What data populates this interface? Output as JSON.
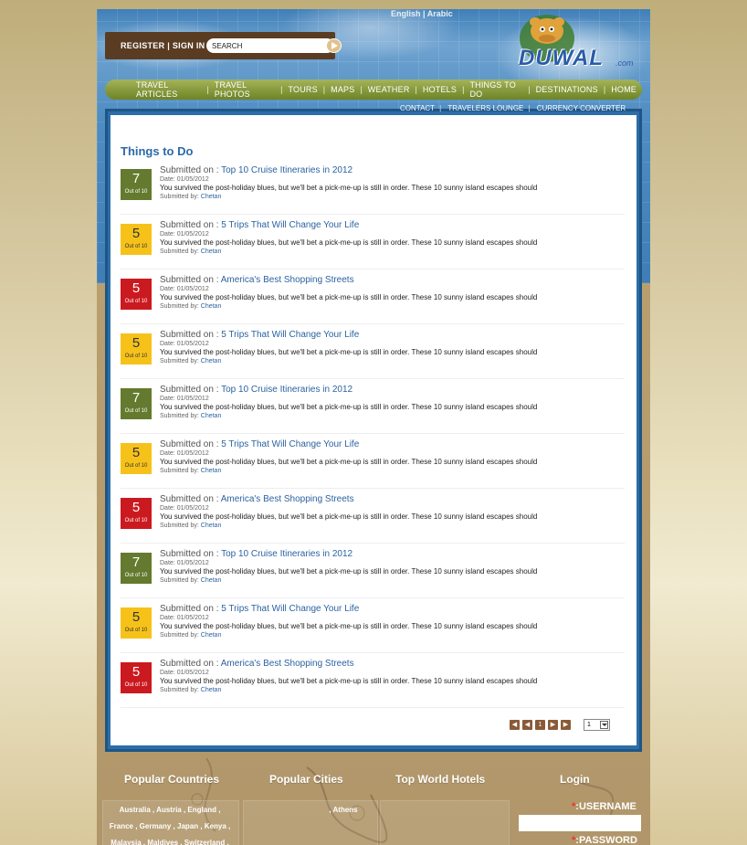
{
  "header": {
    "lang_english": "English",
    "lang_sep": "|",
    "lang_arabic": "Arabic",
    "register": "REGISTER",
    "auth_sep": "|",
    "signin": "SIGN IN",
    "search_placeholder": "SEARCH",
    "logo_text": "DUWAL",
    "logo_domain": ".com"
  },
  "nav": [
    "TRAVEL ARTICLES",
    "TRAVEL PHOTOS",
    "TOURS",
    "MAPS",
    "WEATHER",
    "HOTELS",
    "THINGS TO DO",
    "DESTINATIONS",
    "HOME"
  ],
  "subnav": [
    "CONTACT",
    "TRAVELERS LOUNGE",
    "CURRENCY CONVERTER"
  ],
  "page": {
    "heading": "Things to Do",
    "submitted_on_label": "Submitted on :",
    "date_label": "Date:",
    "submitted_by_label": "Submitted by:",
    "out_of": "Out of 10"
  },
  "items": [
    {
      "score": "7",
      "color": "green",
      "title": "Top 10 Cruise Itineraries in 2012",
      "date": "01/05/2012",
      "desc": "You survived the post-holiday blues, but we'll bet a pick-me-up is still in order. These 10 sunny island escapes should",
      "author": "Chetan"
    },
    {
      "score": "5",
      "color": "yellow",
      "title": "5 Trips That Will Change Your Life",
      "date": "01/05/2012",
      "desc": "You survived the post-holiday blues, but we'll bet a pick-me-up is still in order. These 10 sunny island escapes should",
      "author": "Chetan"
    },
    {
      "score": "5",
      "color": "red",
      "title": "America's Best Shopping Streets",
      "date": "01/05/2012",
      "desc": "You survived the post-holiday blues, but we'll bet a pick-me-up is still in order. These 10 sunny island escapes should",
      "author": "Chetan"
    },
    {
      "score": "5",
      "color": "yellow",
      "title": "5 Trips That Will Change Your Life",
      "date": "01/05/2012",
      "desc": "You survived the post-holiday blues, but we'll bet a pick-me-up is still in order. These 10 sunny island escapes should",
      "author": "Chetan"
    },
    {
      "score": "7",
      "color": "green",
      "title": "Top 10 Cruise Itineraries in 2012",
      "date": "01/05/2012",
      "desc": "You survived the post-holiday blues, but we'll bet a pick-me-up is still in order. These 10 sunny island escapes should",
      "author": "Chetan"
    },
    {
      "score": "5",
      "color": "yellow",
      "title": "5 Trips That Will Change Your Life",
      "date": "01/05/2012",
      "desc": "You survived the post-holiday blues, but we'll bet a pick-me-up is still in order. These 10 sunny island escapes should",
      "author": "Chetan"
    },
    {
      "score": "5",
      "color": "red",
      "title": "America's Best Shopping Streets",
      "date": "01/05/2012",
      "desc": "You survived the post-holiday blues, but we'll bet a pick-me-up is still in order. These 10 sunny island escapes should",
      "author": "Chetan"
    },
    {
      "score": "7",
      "color": "green",
      "title": "Top 10 Cruise Itineraries in 2012",
      "date": "01/05/2012",
      "desc": "You survived the post-holiday blues, but we'll bet a pick-me-up is still in order. These 10 sunny island escapes should",
      "author": "Chetan"
    },
    {
      "score": "5",
      "color": "yellow",
      "title": "5 Trips That Will Change Your Life",
      "date": "01/05/2012",
      "desc": "You survived the post-holiday blues, but we'll bet a pick-me-up is still in order. These 10 sunny island escapes should",
      "author": "Chetan"
    },
    {
      "score": "5",
      "color": "red",
      "title": "America's Best Shopping Streets",
      "date": "01/05/2012",
      "desc": "You survived the post-holiday blues, but we'll bet a pick-me-up is still in order. These 10 sunny island escapes should",
      "author": "Chetan"
    }
  ],
  "pagination": {
    "current": "1",
    "select_value": "1"
  },
  "footer": {
    "popular_countries": "Popular Countries",
    "popular_cities": "Popular Cities",
    "top_world_hotels": "Top World Hotels",
    "login": "Login",
    "countries_line1": "Australia , Austria , England ,",
    "countries_line2": "France , Germany , Japan , Kenya ,",
    "countries_line3": "Malaysia , Maldives , Switzerland ,",
    "cities_line1": ", Athens",
    "username_label": ":USERNAME",
    "password_label": ":PASSWORD",
    "required_mark": "*"
  },
  "colors": {
    "green": "#647a2e",
    "yellow": "#f6c21a",
    "red": "#cb1a1f",
    "link": "#2b63a0",
    "nav": "#7f9230"
  }
}
